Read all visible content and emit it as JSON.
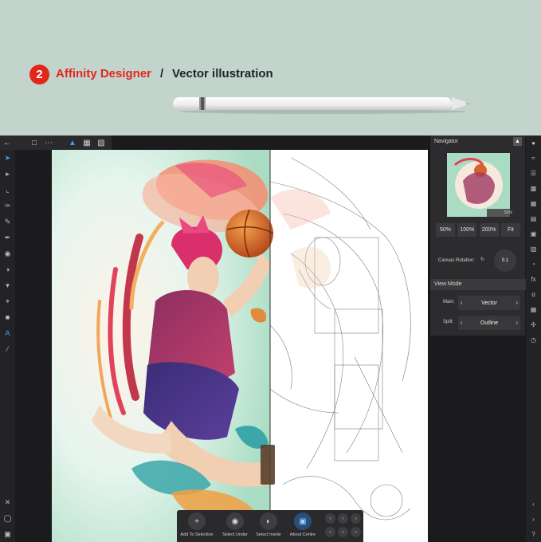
{
  "banner": {
    "step_number": "2",
    "app_name": "Affinity Designer",
    "separator": "/",
    "subtitle": "Vector illustration",
    "accent_color": "#e2261c"
  },
  "top_toolbar": {
    "items": [
      {
        "icon": "back-arrow-icon"
      },
      {
        "icon": "document-icon"
      },
      {
        "icon": "more-icon"
      },
      {
        "icon": "designer-persona-icon",
        "active": true
      },
      {
        "icon": "pixel-persona-icon"
      },
      {
        "icon": "export-persona-icon"
      }
    ]
  },
  "left_tools": [
    "move-tool-icon",
    "node-tool-icon",
    "corner-tool-icon",
    "pen-tool-icon",
    "pencil-tool-icon",
    "vector-brush-icon",
    "fill-tool-icon",
    "transparency-tool-icon",
    "place-image-icon",
    "crop-tool-icon",
    "rectangle-tool-icon",
    "artistic-text-icon",
    "eyedropper-icon"
  ],
  "navigator": {
    "title": "Navigator",
    "zoom_percent": "53%",
    "zoom_buttons": [
      "50%",
      "100%",
      "200%",
      "Fit"
    ],
    "canvas_rotation_label": "Canvas Rotation:",
    "canvas_rotation_value": "0.1",
    "view_mode_title": "View Mode",
    "main_label": "Main:",
    "main_value": "Vector",
    "split_label": "Split:",
    "split_value": "Outline"
  },
  "context_toolbar": {
    "buttons": [
      {
        "label": "Add To Selection",
        "icon": "plus-icon"
      },
      {
        "label": "Select Under",
        "icon": "select-under-icon"
      },
      {
        "label": "Select Inside",
        "icon": "select-inside-icon"
      },
      {
        "label": "About Centre",
        "icon": "transform-centre-icon"
      }
    ]
  },
  "right_tools": [
    "color-icon",
    "stroke-icon",
    "layers-icon",
    "effects-icon",
    "styles-icon",
    "text-styles-icon",
    "stock-icon",
    "navigator-icon",
    "history-icon",
    "transform-icon",
    "glyph-icon",
    "constraints-icon",
    "snapping-icon",
    "assets-icon"
  ],
  "split_handle_label": "Outline"
}
